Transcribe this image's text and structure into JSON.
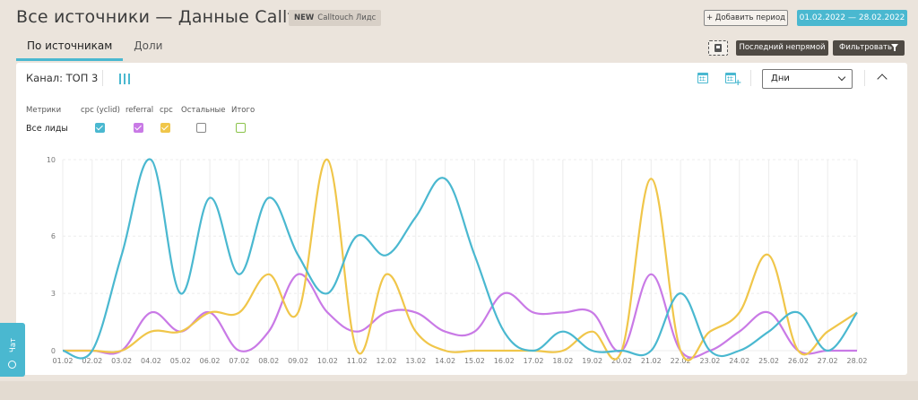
{
  "header": {
    "title": "Все источники — Данные Calltouch",
    "badge_new": "NEW",
    "badge_label": "Calltouch Лидс",
    "add_period_label": "+ Добавить период",
    "date_range": "01.02.2022  —  28.02.2022"
  },
  "tabs": [
    {
      "label": "По источникам",
      "active": true
    },
    {
      "label": "Доли",
      "active": false
    }
  ],
  "toolbar": {
    "save_icon": "save-icon",
    "last_nondirect_label": "Последний непрямой",
    "filter_label": "Фильтровать",
    "filter_icon": "funnel-icon"
  },
  "panel": {
    "channel_label": "Канал: ТОП 3",
    "period_select": "Дни",
    "metrics_label": "Метрики",
    "row_label": "Все лиды"
  },
  "chat": {
    "label": "Чат"
  },
  "colors": {
    "accent": "#4ab8d0",
    "cpc_yclid": "#4ab8d0",
    "referral": "#c97ae6",
    "cpc": "#f0c64a",
    "others": "#888888",
    "total": "#8bc34a"
  },
  "chart_data": {
    "type": "line",
    "categories": [
      "01.02",
      "02.02",
      "03.02",
      "04.02",
      "05.02",
      "06.02",
      "07.02",
      "08.02",
      "09.02",
      "10.02",
      "11.02",
      "12.02",
      "13.02",
      "14.02",
      "15.02",
      "16.02",
      "17.02",
      "18.02",
      "19.02",
      "20.02",
      "21.02",
      "22.02",
      "23.02",
      "24.02",
      "25.02",
      "26.02",
      "27.02",
      "28.02"
    ],
    "y_ticks": [
      0,
      3,
      6,
      10
    ],
    "ylim": [
      0,
      10
    ],
    "grid": true,
    "series": [
      {
        "name": "cpc (yclid)",
        "color": "#4ab8d0",
        "checked": true,
        "values": [
          0,
          0,
          5,
          10,
          3,
          8,
          4,
          8,
          5,
          3,
          6,
          5,
          7,
          9,
          5,
          1,
          0,
          1,
          0,
          0,
          0,
          3,
          0,
          0,
          1,
          2,
          0,
          2
        ]
      },
      {
        "name": "referral",
        "color": "#c97ae6",
        "checked": true,
        "values": [
          0,
          0,
          0,
          2,
          1,
          2,
          0,
          1,
          4,
          2,
          1,
          2,
          2,
          1,
          1,
          3,
          2,
          2,
          2,
          0,
          4,
          0,
          0,
          1,
          2,
          0,
          0,
          0
        ]
      },
      {
        "name": "cpc",
        "color": "#f0c64a",
        "checked": true,
        "values": [
          0,
          0,
          0,
          1,
          1,
          2,
          2,
          4,
          2,
          10,
          0,
          4,
          1,
          0,
          0,
          0,
          0,
          0,
          1,
          0,
          9,
          0,
          1,
          2,
          5,
          0,
          1,
          2
        ]
      },
      {
        "name": "Остальные",
        "color": "#888888",
        "checked": false,
        "values": []
      },
      {
        "name": "Итого",
        "color": "#8bc34a",
        "checked": false,
        "values": []
      }
    ]
  }
}
